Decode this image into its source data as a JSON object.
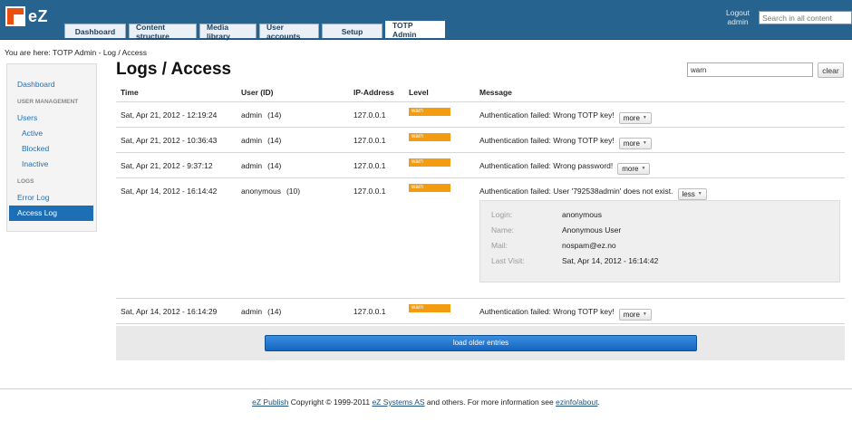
{
  "header": {
    "logo_text": "eZ",
    "tabs": [
      {
        "label": "Dashboard"
      },
      {
        "label": "Content structure"
      },
      {
        "label": "Media library"
      },
      {
        "label": "User accounts"
      },
      {
        "label": "Setup"
      },
      {
        "label": "TOTP Admin"
      }
    ],
    "active_tab": "TOTP Admin",
    "logout_label": "Logout",
    "username": "admin",
    "search_placeholder": "Search in all content"
  },
  "breadcrumb": "You are here: TOTP Admin - Log / Access",
  "sidebar": {
    "dashboard": "Dashboard",
    "user_management_heading": "USER MANAGEMENT",
    "users": "Users",
    "active": "Active",
    "blocked": "Blocked",
    "inactive": "Inactive",
    "logs_heading": "LOGS",
    "error_log": "Error Log",
    "access_log": "Access Log"
  },
  "page_title": "Logs / Access",
  "filter": {
    "value": "warn",
    "clear_label": "clear"
  },
  "table": {
    "headers": {
      "time": "Time",
      "user": "User (ID)",
      "ip": "IP-Address",
      "level": "Level",
      "message": "Message"
    },
    "rows": [
      {
        "time": "Sat, Apr 21, 2012 - 12:19:24",
        "user": "admin",
        "id": "(14)",
        "ip": "127.0.0.1",
        "level": "warn",
        "message": "Authentication failed: Wrong TOTP key!",
        "toggle": "more"
      },
      {
        "time": "Sat, Apr 21, 2012 - 10:36:43",
        "user": "admin",
        "id": "(14)",
        "ip": "127.0.0.1",
        "level": "warn",
        "message": "Authentication failed: Wrong TOTP key!",
        "toggle": "more"
      },
      {
        "time": "Sat, Apr 21, 2012 - 9:37:12",
        "user": "admin",
        "id": "(14)",
        "ip": "127.0.0.1",
        "level": "warn",
        "message": "Authentication failed: Wrong password!",
        "toggle": "more"
      },
      {
        "time": "Sat, Apr 14, 2012 - 16:14:42",
        "user": "anonymous",
        "id": "(10)",
        "ip": "127.0.0.1",
        "level": "warn",
        "message": "Authentication failed: User '792538admin' does not exist.",
        "toggle": "less"
      },
      {
        "time": "Sat, Apr 14, 2012 - 16:14:29",
        "user": "admin",
        "id": "(14)",
        "ip": "127.0.0.1",
        "level": "warn",
        "message": "Authentication failed: Wrong TOTP key!",
        "toggle": "more"
      }
    ],
    "detail": {
      "login_label": "Login:",
      "login": "anonymous",
      "name_label": "Name:",
      "name": "Anonymous User",
      "mail_label": "Mail:",
      "mail": "nospam@ez.no",
      "last_visit_label": "Last Visit:",
      "last_visit": "Sat, Apr 14, 2012 - 16:14:42"
    }
  },
  "load_older_label": "load older entries",
  "footer": {
    "product": "eZ Publish",
    "copyright": " Copyright © 1999-2011 ",
    "company": "eZ Systems AS",
    "tail": " and others. For more information see ",
    "link": "ezinfo/about",
    "end": "."
  },
  "colors": {
    "header_bg": "#27638f",
    "accent": "#1d6fb5",
    "warn": "#f39c12"
  }
}
